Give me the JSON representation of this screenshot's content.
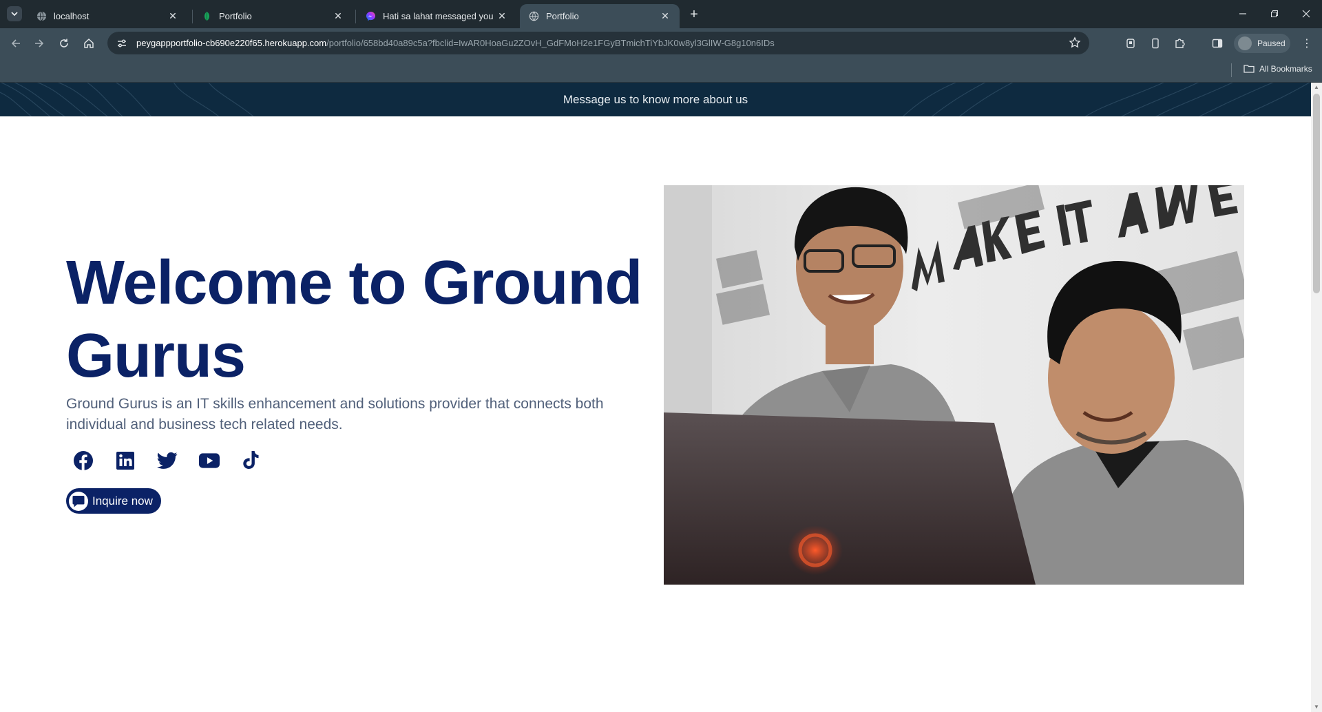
{
  "browser": {
    "tabs": [
      {
        "title": "localhost",
        "favicon": "globe-icon",
        "active": false
      },
      {
        "title": "Portfolio",
        "favicon": "leaf-icon",
        "active": false
      },
      {
        "title": "Hati sa lahat messaged you",
        "favicon": "messenger-icon",
        "active": false
      },
      {
        "title": "Portfolio",
        "favicon": "globe-icon",
        "active": true
      }
    ],
    "url_host": "peygappportfolio-cb690e220f65.herokuapp.com",
    "url_path": "/portfolio/658bd40a89c5a?fbclid=IwAR0HoaGu2ZOvH_GdFMoH2e1FGyBTmichTiYbJK0w8yl3GlIW-G8g10n6IDs",
    "profile_label": "Paused",
    "bookmarks_label": "All Bookmarks"
  },
  "banner": {
    "text": "Message us to know more about us"
  },
  "hero": {
    "title": "Welcome to Ground Gurus",
    "description": "Ground Gurus is an IT skills enhancement and solutions provider that connects both individual and business tech related needs.",
    "socials": [
      "facebook-icon",
      "linkedin-icon",
      "twitter-icon",
      "youtube-icon",
      "tiktok-icon"
    ],
    "cta_label": "Inquire now"
  },
  "colors": {
    "brand_navy": "#0b2266",
    "banner_bg": "#0e2a40",
    "chrome_dark": "#202a30",
    "chrome_toolbar": "#3c4d58"
  }
}
